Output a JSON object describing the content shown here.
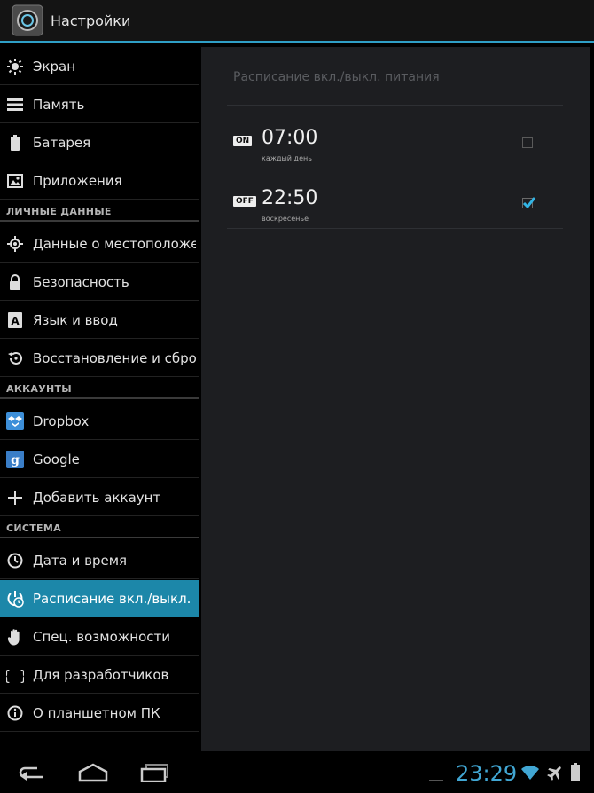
{
  "action_bar": {
    "title": "Настройки"
  },
  "sidebar": {
    "items_top": [
      {
        "label": "Экран"
      },
      {
        "label": "Память"
      },
      {
        "label": "Батарея"
      },
      {
        "label": "Приложения"
      }
    ],
    "section_personal": "ЛИЧНЫЕ ДАННЫЕ",
    "items_personal": [
      {
        "label": "Данные о местоположе"
      },
      {
        "label": "Безопасность"
      },
      {
        "label": "Язык и ввод"
      },
      {
        "label": "Восстановление и сброс"
      }
    ],
    "section_accounts": "АККАУНТЫ",
    "items_accounts": [
      {
        "label": "Dropbox"
      },
      {
        "label": "Google"
      },
      {
        "label": "Добавить аккаунт"
      }
    ],
    "section_system": "СИСТЕМА",
    "items_system": [
      {
        "label": "Дата и время"
      },
      {
        "label": "Расписание вкл./выкл."
      },
      {
        "label": "Спец. возможности"
      },
      {
        "label": "Для разработчиков"
      },
      {
        "label": "О планшетном ПК"
      }
    ],
    "active_item": "Расписание вкл./выкл."
  },
  "content": {
    "title": "Расписание вкл./выкл. питания",
    "schedules": [
      {
        "badge": "ON",
        "time": "07:00",
        "repeat": "каждый день",
        "enabled": false
      },
      {
        "badge": "OFF",
        "time": "22:50",
        "repeat": "воскресенье",
        "enabled": true
      }
    ]
  },
  "status_bar": {
    "time": "23:29"
  },
  "colors": {
    "accent": "#1c87a9",
    "clock": "#41a6d3"
  }
}
